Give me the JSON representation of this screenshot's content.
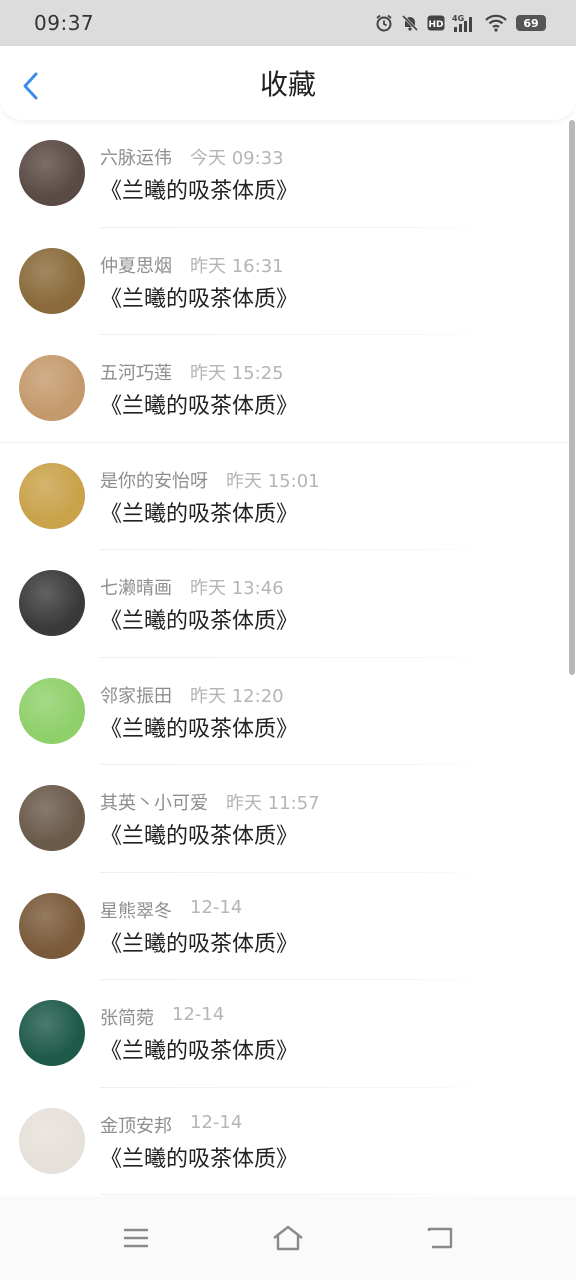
{
  "status_bar": {
    "time": "09:37",
    "battery": "69",
    "network": "4G",
    "hd_label": "HD",
    "icons": [
      "alarm-icon",
      "mute-icon",
      "hd-icon",
      "signal-icon",
      "wifi-icon",
      "battery-icon"
    ]
  },
  "header": {
    "title": "收藏",
    "back_icon": "chevron-left-icon",
    "accent_color": "#3a8ee6"
  },
  "items": [
    {
      "name": "六脉运伟",
      "time": "今天 09:33",
      "title": "《兰曦的吸茶体质》",
      "avatar_color": "#5a4a44"
    },
    {
      "name": "仲夏思烟",
      "time": "昨天 16:31",
      "title": "《兰曦的吸茶体质》",
      "avatar_color": "#8a6a3a"
    },
    {
      "name": "五河巧莲",
      "time": "昨天 15:25",
      "title": "《兰曦的吸茶体质》",
      "avatar_color": "#c49a6c"
    },
    {
      "name": "是你的安怡呀",
      "time": "昨天 15:01",
      "title": "《兰曦的吸茶体质》",
      "avatar_color": "#c9a24a"
    },
    {
      "name": "七濑晴画",
      "time": "昨天 13:46",
      "title": "《兰曦的吸茶体质》",
      "avatar_color": "#3a3a3a"
    },
    {
      "name": "邻家振田",
      "time": "昨天 12:20",
      "title": "《兰曦的吸茶体质》",
      "avatar_color": "#8fd06a"
    },
    {
      "name": "其英丶小可爱",
      "time": "昨天 11:57",
      "title": "《兰曦的吸茶体质》",
      "avatar_color": "#6a5a4a"
    },
    {
      "name": "星熊翠冬",
      "time": "12-14",
      "title": "《兰曦的吸茶体质》",
      "avatar_color": "#7a5a3a"
    },
    {
      "name": "张简菀",
      "time": "12-14",
      "title": "《兰曦的吸茶体质》",
      "avatar_color": "#1e5a4a"
    },
    {
      "name": "金顶安邦",
      "time": "12-14",
      "title": "《兰曦的吸茶体质》",
      "avatar_color": "#e6e0da"
    }
  ],
  "bottom_nav": {
    "menu_icon": "menu-icon",
    "home_icon": "home-icon",
    "back_icon": "return-icon"
  }
}
